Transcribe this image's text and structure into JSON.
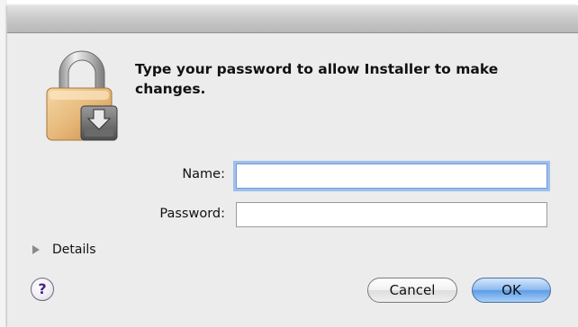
{
  "dialog": {
    "prompt": "Type your password to allow Installer to make changes.",
    "lock_icon": "lock-icon"
  },
  "fields": {
    "name_label": "Name:",
    "name_value": "",
    "password_label": "Password:",
    "password_value": ""
  },
  "details": {
    "label": "Details",
    "icon": "disclosure-triangle-icon"
  },
  "buttons": {
    "help_label": "?",
    "cancel_label": "Cancel",
    "ok_label": "OK"
  },
  "colors": {
    "dialog_background": "#ececec",
    "focus_ring": "#9fc0eb",
    "default_button": "#5e9ce6"
  }
}
